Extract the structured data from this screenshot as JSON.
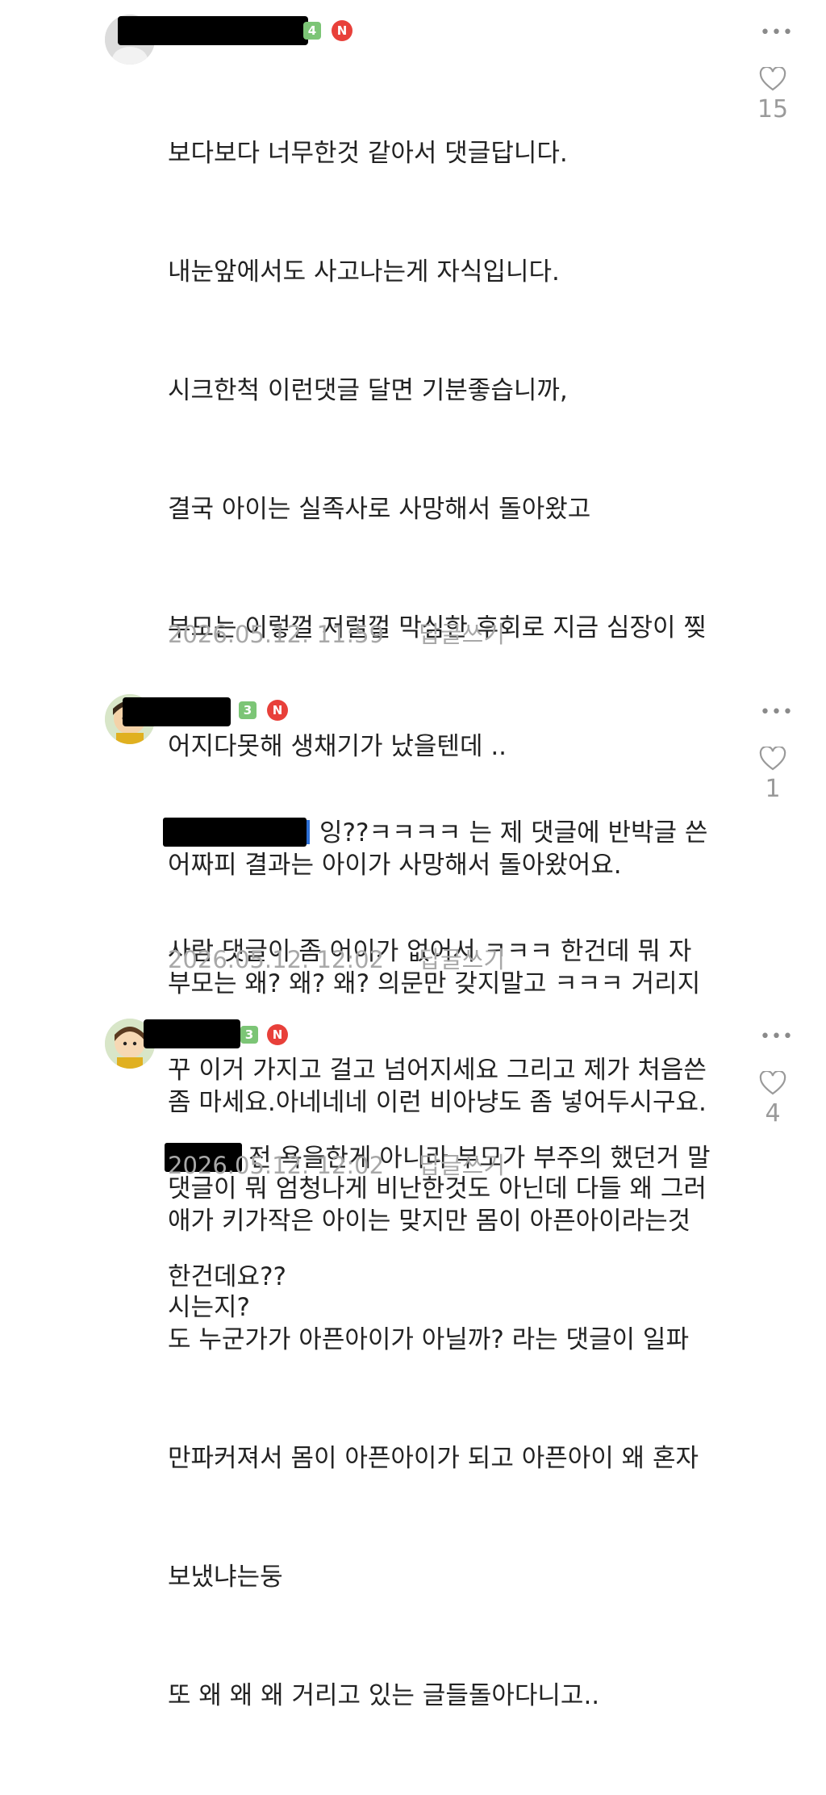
{
  "comments": [
    {
      "level": "4",
      "new_badge": "N",
      "lines": [
        "보다보다 너무한것 같아서 댓글답니다.",
        "내눈앞에서도 사고나는게 자식입니다.",
        "시크한척 이런댓글 달면 기분좋습니까,",
        "결국 아이는 실족사로 사망해서 돌아왔고",
        "부모는 이렇껄 저럴껄 막심한 후회로 지금 심장이 찢",
        "어지다못해 생채기가 났을텐데 ..",
        "어짜피 결과는 아이가 사망해서 돌아왔어요.",
        "부모는 왜? 왜? 왜? 의문만 갖지말고 ㅋㅋㅋ 거리지",
        "좀 마세요.아네네네 이런 비아냥도 좀 넣어두시구요.",
        "애가 키가작은 아이는 맞지만 몸이 아픈아이라는것",
        "도 누군가가 아픈아이가 아닐까? 라는 댓글이 일파",
        "만파커져서 몸이 아픈아이가 되고 아픈아이 왜 혼자",
        "보냈냐는둥",
        "또 왜 왜 왜 거리고 있는 글들돌아다니고.."
      ],
      "timestamp": "2026.05.12. 11:59",
      "reply_label": "답글쓰기",
      "likes": "15"
    },
    {
      "level": "3",
      "new_badge": "N",
      "lines": [
        "잉??ㅋㅋㅋㅋ 는 제 댓글에 반박글 쓴",
        "사람 댓글이 좀 어이가 없어서 ㅋㅋㅋ 한건데 뭐 자",
        "꾸 이거 가지고 걸고 넘어지세요 그리고 제가 처음쓴",
        "댓글이 뭐 엄청나게 비난한것도 아닌데 다들 왜 그러",
        "시는지?"
      ],
      "timestamp": "2026.05.12. 12:02",
      "reply_label": "답글쓰기",
      "likes": "1"
    },
    {
      "level": "3",
      "new_badge": "N",
      "lines": [
        "전 욕을한게 아니라 부모가 부주의 했던거 말",
        "한건데요??"
      ],
      "timestamp": "2026.05.12. 12:02",
      "reply_label": "답글쓰기",
      "likes": "4"
    }
  ],
  "icons": {
    "more": "more-options-icon",
    "like": "heart-outline-icon"
  },
  "colors": {
    "new_badge": "#e8403a",
    "level_badge": "#7cc576",
    "meta_text": "#a8a8a8",
    "mention_edge": "#2c6fd6"
  }
}
